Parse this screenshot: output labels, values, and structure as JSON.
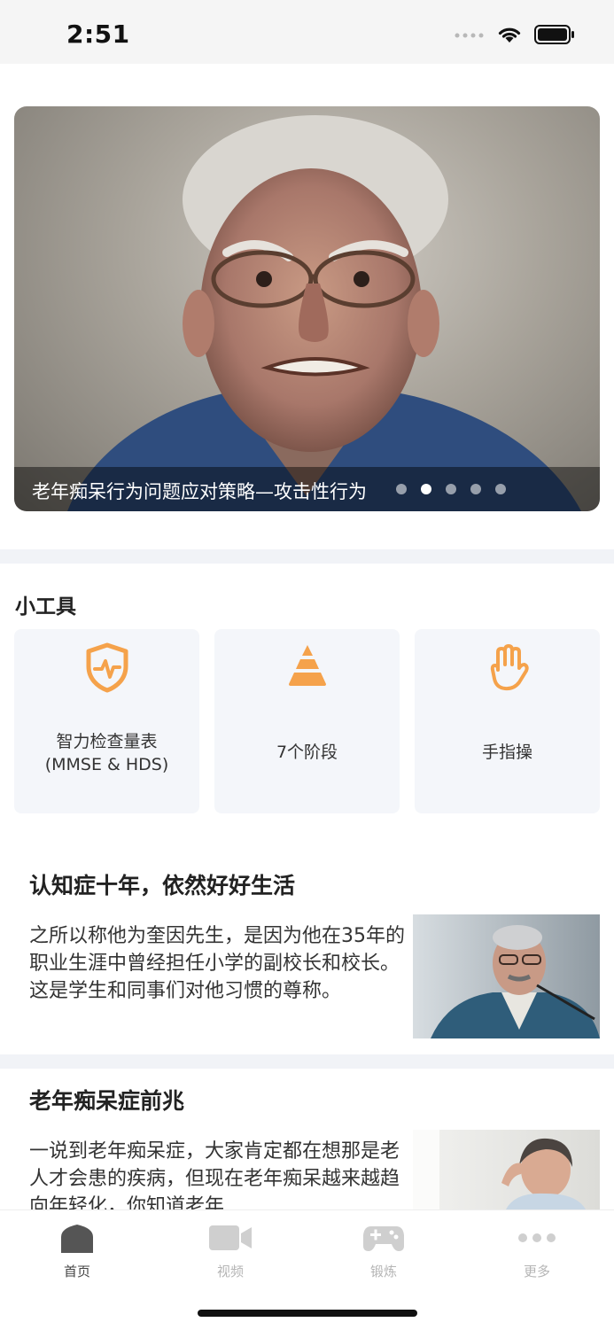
{
  "status_bar": {
    "time": "2:51"
  },
  "banner": {
    "caption": "老年痴呆行为问题应对策略—攻击性行为",
    "dot_count": 5,
    "active_dot": 1
  },
  "tools": {
    "title": "小工具",
    "items": [
      {
        "label": "智力检查量表\n(MMSE & HDS)",
        "icon": "shield-heartbeat-icon"
      },
      {
        "label": "7个阶段",
        "icon": "pyramid-icon"
      },
      {
        "label": "手指操",
        "icon": "hand-icon"
      }
    ]
  },
  "articles": [
    {
      "title": "认知症十年，依然好好生活",
      "body": "之所以称他为奎因先生，是因为他在35年的职业生涯中曾经担任小学的副校长和校长。这是学生和同事们对他习惯的尊称。",
      "thumb": "speaker-photo"
    },
    {
      "title": "老年痴呆症前兆",
      "body": "一说到老年痴呆症，大家肯定都在想那是老人才会患的疾病，但现在老年痴呆越来越趋向年轻化，你知道老年",
      "thumb": "elderly-woman-photo"
    }
  ],
  "tabbar": {
    "items": [
      {
        "label": "首页",
        "icon": "home-icon",
        "active": true
      },
      {
        "label": "视频",
        "icon": "video-camera-icon",
        "active": false
      },
      {
        "label": "锻炼",
        "icon": "gamepad-icon",
        "active": false
      },
      {
        "label": "更多",
        "icon": "more-dots-icon",
        "active": false
      }
    ]
  },
  "colors": {
    "accent": "#f5a24b",
    "card_bg": "#f4f6fa",
    "divider": "#f1f3f7"
  }
}
